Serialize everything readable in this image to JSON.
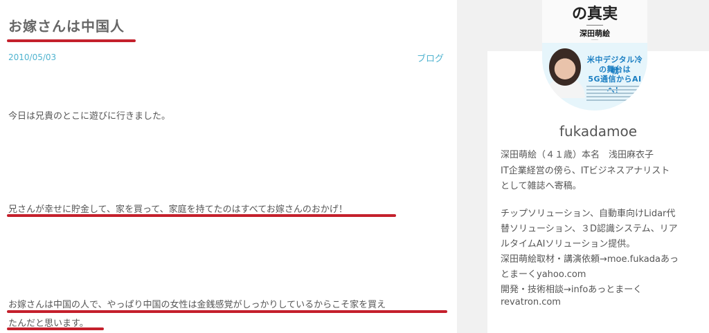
{
  "post": {
    "title": "お嫁さんは中国人",
    "date": "2010/05/03",
    "category": "ブログ",
    "paragraphs": [
      "今日は兄貴のとこに遊びに行きました。",
      "兄さんが幸せに貯金して、家を買って、家庭を持てたのはすべてお嫁さんのおかげ！",
      "お嫁さんは中国の人で、やっぱり中国の女性は金銭感覚がしっかりしているからこそ家を買え",
      "たんだと思います。"
    ]
  },
  "sidebar": {
    "avatar_cover": {
      "title": "の真実",
      "author": "深田萌絵",
      "line1": "米中デジタル冷戦",
      "line2": "の舞台は",
      "line3": "5G通信からAIへ！"
    },
    "username": "fukadamoe",
    "bio_lines": [
      "深田萌絵（４１歳）本名　浅田麻衣子",
      "IT企業経営の傍ら、ITビジネスアナリスト",
      "として雑誌へ寄稿。",
      "チップソリューション、自動車向けLidar代",
      "替ソリューション、３D認識システム、リア",
      "ルタイムAIソリューション提供。",
      "深田萌絵取材・講演依頼→moe.fukadaあっ",
      "とまーくyahoo.com",
      "開発・技術相談→infoあっとまーく",
      "revatron.com"
    ]
  },
  "colors": {
    "accent_red": "#c4202c",
    "link_blue": "#4fb3cf"
  }
}
